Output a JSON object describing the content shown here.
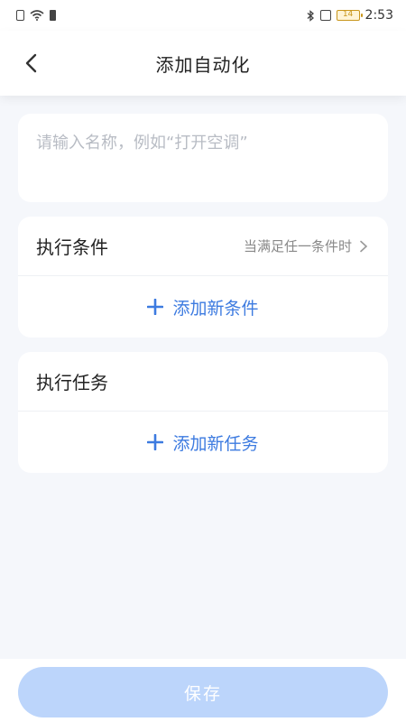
{
  "status_bar": {
    "time": "2:53",
    "battery": "14",
    "icons": [
      "sim-icon",
      "wifi-icon",
      "battery-icon",
      "bluetooth-icon",
      "vibrate-icon"
    ]
  },
  "nav": {
    "title": "添加自动化",
    "back_icon": "chevron-left-icon"
  },
  "name_field": {
    "placeholder": "请输入名称，例如“打开空调”",
    "value": ""
  },
  "conditions": {
    "title": "执行条件",
    "mode": "当满足任一条件时",
    "add_label": "添加新条件"
  },
  "tasks": {
    "title": "执行任务",
    "add_label": "添加新任务"
  },
  "footer": {
    "save_label": "保存"
  },
  "colors": {
    "accent": "#3d7be0",
    "save_disabled": "#bcd5fb",
    "background": "#f5f7fb"
  }
}
